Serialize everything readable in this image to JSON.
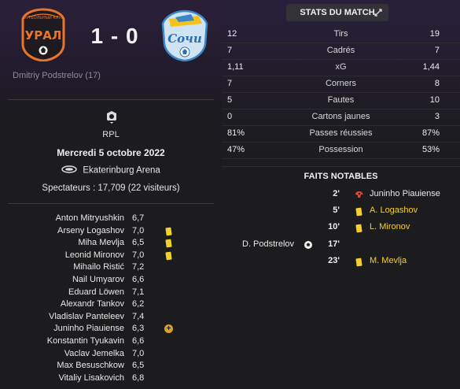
{
  "match": {
    "home_score": "1",
    "separator": "-",
    "away_score": "0",
    "scorer": "Dmitriy Podstrelov (17)",
    "home_crest_text": "УРАЛ",
    "away_crest_text": "Сочи"
  },
  "info": {
    "competition": "RPL",
    "date": "Mercredi 5 octobre 2022",
    "venue": "Ekaterinburg Arena",
    "spectators": "Spectateurs : 17,709 (22 visiteurs)"
  },
  "players": [
    {
      "name": "Anton Mitryushkin",
      "rating": "6,7",
      "event": ""
    },
    {
      "name": "Arseny Logashov",
      "rating": "7,0",
      "event": "yellow-card"
    },
    {
      "name": "Miha Mevlja",
      "rating": "6,5",
      "event": "yellow-card"
    },
    {
      "name": "Leonid Mironov",
      "rating": "7,0",
      "event": "yellow-card"
    },
    {
      "name": "Mihailo Ristić",
      "rating": "7,2",
      "event": ""
    },
    {
      "name": "Nail Umyarov",
      "rating": "6,6",
      "event": ""
    },
    {
      "name": "Eduard Löwen",
      "rating": "7,1",
      "event": ""
    },
    {
      "name": "Alexandr Tankov",
      "rating": "6,2",
      "event": ""
    },
    {
      "name": "Vladislav Panteleev",
      "rating": "7,4",
      "event": ""
    },
    {
      "name": "Juninho Piauiense",
      "rating": "6,3",
      "event": "substitution"
    },
    {
      "name": "Konstantin Tyukavin",
      "rating": "6,6",
      "event": ""
    },
    {
      "name": "Vaclav Jemelka",
      "rating": "7,0",
      "event": ""
    },
    {
      "name": "Max Besuschkow",
      "rating": "6,5",
      "event": ""
    },
    {
      "name": "Vitaliy Lisakovich",
      "rating": "6,8",
      "event": ""
    }
  ],
  "stats": {
    "header": "STATS DU MATCH",
    "rows": [
      {
        "home": "12",
        "label": "Tirs",
        "away": "19"
      },
      {
        "home": "7",
        "label": "Cadrés",
        "away": "7"
      },
      {
        "home": "1,11",
        "label": "xG",
        "away": "1,44"
      },
      {
        "home": "7",
        "label": "Corners",
        "away": "8"
      },
      {
        "home": "5",
        "label": "Fautes",
        "away": "10"
      },
      {
        "home": "0",
        "label": "Cartons jaunes",
        "away": "3"
      },
      {
        "home": "81%",
        "label": "Passes réussies",
        "away": "87%"
      },
      {
        "home": "47%",
        "label": "Possession",
        "away": "53%"
      }
    ]
  },
  "events": {
    "header": "FAITS NOTABLES",
    "rows": [
      {
        "minute": "2'",
        "side": "away",
        "type": "injury",
        "player": "Juninho Piauiense"
      },
      {
        "minute": "5'",
        "side": "away",
        "type": "yellow-card",
        "player": "A. Logashov"
      },
      {
        "minute": "10'",
        "side": "away",
        "type": "yellow-card",
        "player": "L. Mironov"
      },
      {
        "minute": "17'",
        "side": "home",
        "type": "goal",
        "player": "D. Podstrelov"
      },
      {
        "minute": "23'",
        "side": "away",
        "type": "yellow-card",
        "player": "M. Mevlja"
      }
    ]
  },
  "colors": {
    "yellow_card": "#f5d02a",
    "home_crest": "#e8752a",
    "away_crest": "#3d86c6"
  }
}
